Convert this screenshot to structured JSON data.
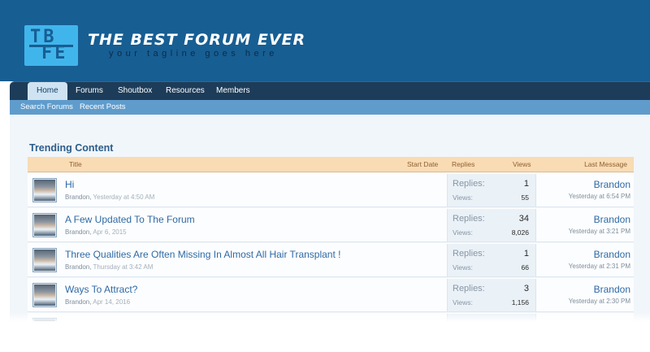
{
  "site": {
    "logo_line1": "TB",
    "logo_line2": "FE",
    "title": "THE BEST FORUM EVER",
    "tagline": "your tagline goes here"
  },
  "nav": {
    "tabs": [
      {
        "label": "Home",
        "active": true
      },
      {
        "label": "Forums"
      },
      {
        "label": "Shoutbox"
      },
      {
        "label": "Resources"
      },
      {
        "label": "Members"
      }
    ]
  },
  "subnav": {
    "items": [
      {
        "label": "Search Forums"
      },
      {
        "label": "Recent Posts"
      }
    ]
  },
  "trending": {
    "title": "Trending Content",
    "columns": {
      "title": "Title",
      "start_date": "Start Date",
      "replies": "Replies",
      "views": "Views",
      "last_message": "Last Message"
    },
    "replies_label": "Replies:",
    "views_label": "Views:",
    "rows": [
      {
        "title": "Hi",
        "author": "Brandon,",
        "date": "Yesterday at 4:50 AM",
        "replies": "1",
        "views": "55",
        "last_user": "Brandon",
        "last_time": "Yesterday at 6:54 PM"
      },
      {
        "title": "A Few Updated To The Forum",
        "author": "Brandon,",
        "date": "Apr 6, 2015",
        "replies": "34",
        "views": "8,026",
        "last_user": "Brandon",
        "last_time": "Yesterday at 3:21 PM"
      },
      {
        "title": "Three Qualities Are Often Missing In Almost All Hair Transplant !",
        "author": "Brandon,",
        "date": "Thursday at 3:42 AM",
        "replies": "1",
        "views": "66",
        "last_user": "Brandon",
        "last_time": "Yesterday at 2:31 PM"
      },
      {
        "title": "Ways To Attract?",
        "author": "Brandon,",
        "date": "Apr 14, 2016",
        "replies": "3",
        "views": "1,156",
        "last_user": "Brandon",
        "last_time": "Yesterday at 2:30 PM"
      }
    ]
  },
  "colors": {
    "header_bg": "#175e93",
    "accent": "#40b5ec",
    "nav_bg": "#1c3c59",
    "subnav_bg": "#5f9ccc",
    "link": "#2f6aa5",
    "table_head_bg": "#f9dbb4"
  }
}
